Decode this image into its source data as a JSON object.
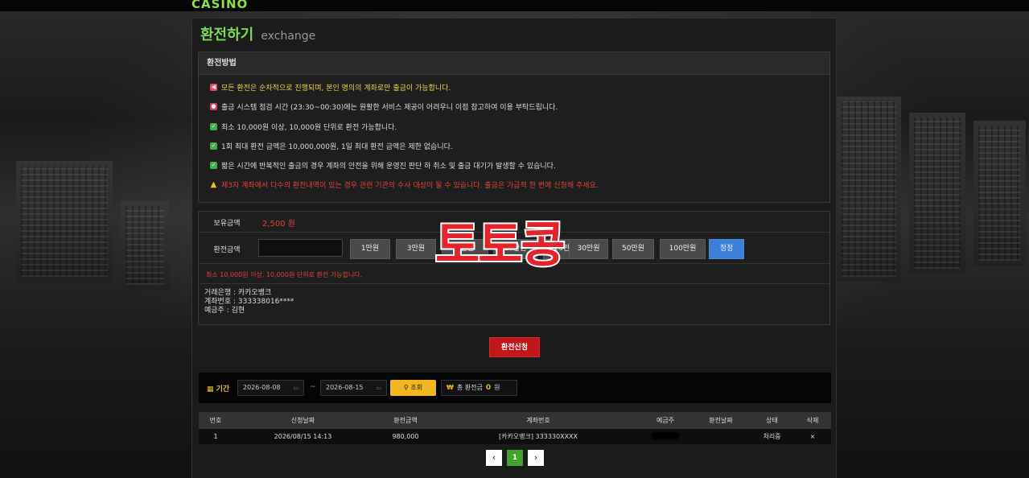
{
  "header": {
    "logo": "CASINO"
  },
  "page": {
    "title_ko": "환전하기",
    "title_en": "exchange"
  },
  "notice": {
    "heading": "환전방법",
    "lines": [
      {
        "icon": "megaphone-icon",
        "text": "모든 환전은 순차적으로 진행되며, 본인 명의의 계좌로만 출금이 가능합니다.",
        "color": "#f3d34a"
      },
      {
        "icon": "alarm-icon",
        "text": "출금 시스템 점검 시간 (23:30~00:30)에는 원활한 서비스 제공이 어려우니 이점 참고하여 이용 부탁드립니다.",
        "color": "#dddddd"
      },
      {
        "icon": "checkbox-icon",
        "text": "최소 10,000원 이상, 10,000원 단위로 환전 가능합니다.",
        "color": "#dddddd"
      },
      {
        "icon": "checkbox-icon",
        "text": "1회 최대 환전 금액은 10,000,000원, 1일 최대 환전 금액은 제한 없습니다.",
        "color": "#dddddd"
      },
      {
        "icon": "checkbox-icon",
        "text": "짧은 시간에 반복적인 출금의 경우 계좌의 안전을 위해 운영진 판단 하 취소 및 출금 대기가 발생할 수 있습니다.",
        "color": "#dddddd"
      },
      {
        "icon": "warning-icon",
        "text": "제3자 계좌에서 다수의 환전내역이 있는 경우 관련 기관의 수사 대상이 될 수 있습니다. 출금은 가급적 한 번에 신청해 주세요.",
        "color": "#e0443c"
      }
    ]
  },
  "form": {
    "balance_label": "보유금액",
    "balance_value": "2,500 원",
    "amount_label": "환전금액",
    "amount_value": "",
    "amount_buttons": [
      "1만원",
      "3만원",
      "5만원",
      "10만원",
      "20만원",
      "30만원",
      "50만원",
      "100만원"
    ],
    "reset_label": "정정",
    "hint": "최소 10,000원 이상, 10,000원 단위로 환전 가능합니다.",
    "bank_name": "거래은행 : 카카오뱅크",
    "account_number": "계좌번호 : 333338016****",
    "holder": "예금주 : 김현"
  },
  "submit_label": "환전신청",
  "search": {
    "period_label": "기간",
    "date_from": "2026-08-08",
    "date_to": "2026-08-15",
    "tilde": "~",
    "search_label": "조회",
    "total_label": "총 환전금",
    "total_value": "0",
    "total_unit": "원"
  },
  "table": {
    "headers": [
      "번호",
      "신청날짜",
      "환전금액",
      "계좌번호",
      "예금주",
      "환전날짜",
      "상태",
      "삭제"
    ],
    "rows": [
      [
        "1",
        "2026/08/15 14:13",
        "980,000",
        "[카카오뱅크] 333330XXXX",
        "",
        "",
        "처리중",
        "×"
      ]
    ]
  },
  "pagination": {
    "prev": "‹",
    "current": "1",
    "next": "›"
  },
  "watermark": "토토콩",
  "colors": {
    "accent_green": "#7ed957",
    "alert_red": "#e0443c",
    "submit_red": "#c0161c",
    "search_yellow": "#f2b620",
    "reset_blue": "#3b7fd6"
  }
}
